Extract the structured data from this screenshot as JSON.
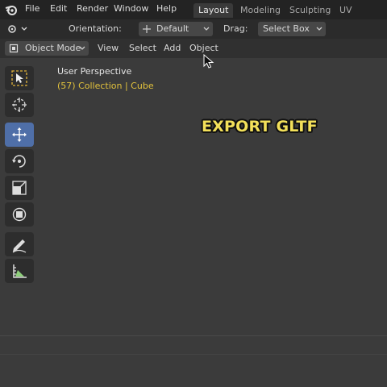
{
  "menubar": {
    "items": [
      "File",
      "Edit",
      "Render",
      "Window",
      "Help"
    ],
    "workspaces": [
      {
        "label": "Layout",
        "active": true
      },
      {
        "label": "Modeling",
        "active": false
      },
      {
        "label": "Sculpting",
        "active": false
      },
      {
        "label": "UV Editing",
        "active": false
      }
    ]
  },
  "tool_header": {
    "orientation_label": "Orientation:",
    "orientation_value": "Default",
    "drag_label": "Drag:",
    "drag_value": "Select Box"
  },
  "viewport_header": {
    "mode": "Object Mode",
    "menus": [
      "View",
      "Select",
      "Add",
      "Object"
    ]
  },
  "viewport": {
    "perspective": "User Perspective",
    "collection": "(57) Collection | Cube"
  },
  "overlay_text": "EXPORT GLTF",
  "colors": {
    "accent": "#4f6fa8",
    "collection_text": "#e2c23c",
    "overlay_text": "#f3e05a"
  },
  "toolbar_tools": [
    "select-box-icon",
    "cursor-icon",
    "move-icon",
    "rotate-icon",
    "scale-icon",
    "transform-icon",
    "annotate-icon",
    "measure-icon"
  ]
}
